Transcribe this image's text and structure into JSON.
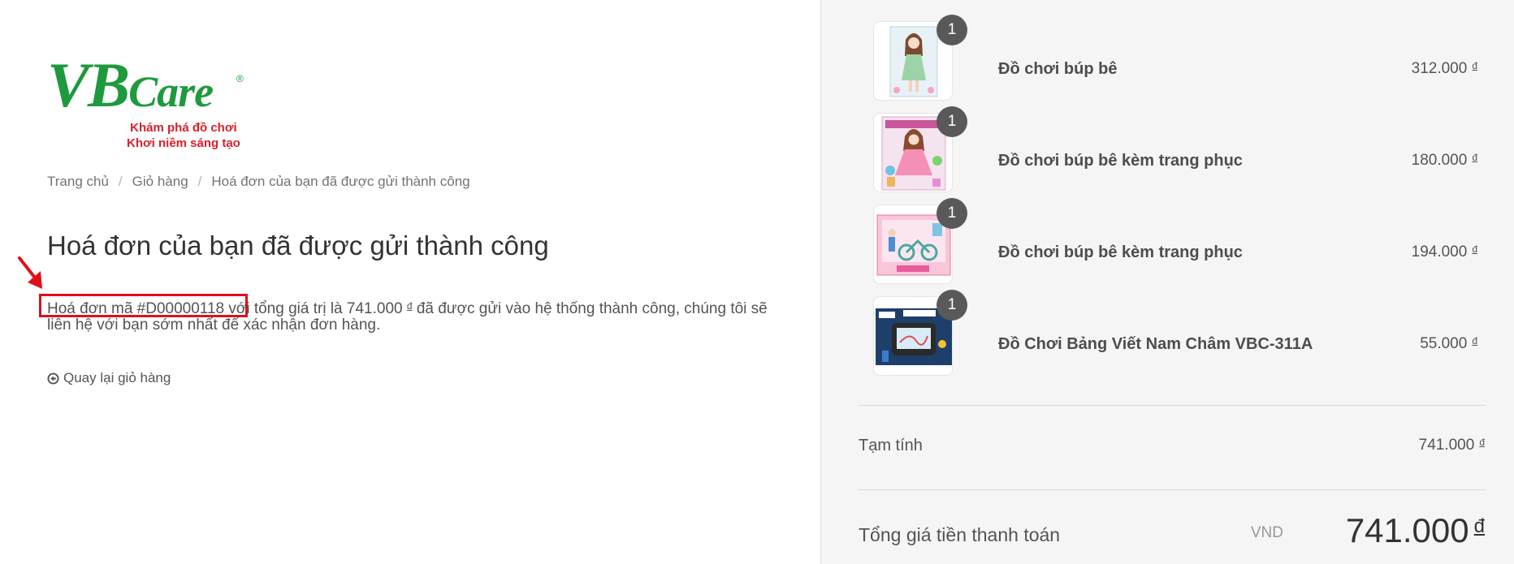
{
  "logo": {
    "brand_vb": "VB",
    "brand_care": "Care",
    "reg": "®",
    "tagline_1": "Khám phá đồ chơi",
    "tagline_2": "Khơi niềm sáng tạo"
  },
  "breadcrumb": {
    "home": "Trang chủ",
    "cart": "Giỏ hàng",
    "current": "Hoá đơn của bạn đã được gửi thành công",
    "separator": "/"
  },
  "page_title": "Hoá đơn của bạn đã được gửi thành công",
  "message": {
    "ref_text": "Hoá đơn mã #D00000118",
    "part1": " với tổng giá trị là 741.000 ",
    "currency": "đ",
    "part2": " đã được gửi vào hệ thống thành công, chúng tôi sẽ liên hệ với bạn sớm nhất để xác nhận đơn hàng."
  },
  "back_link": "Quay lại giỏ hàng",
  "items": [
    {
      "qty": "1",
      "name": "Đồ chơi búp bê",
      "price": "312.000",
      "currency": "đ",
      "thumb": "doll-in-box"
    },
    {
      "qty": "1",
      "name": "Đồ chơi búp bê kèm trang phục",
      "price": "180.000",
      "currency": "đ",
      "thumb": "doll-pink-dress"
    },
    {
      "qty": "1",
      "name": "Đồ chơi búp bê kèm trang phục",
      "price": "194.000",
      "currency": "đ",
      "thumb": "doll-bicycle-set"
    },
    {
      "qty": "1",
      "name": "Đồ Chơi Bảng Viết Nam Châm VBC-311A",
      "price": "55.000",
      "currency": "đ",
      "thumb": "magnetic-drawing-board"
    }
  ],
  "summary": {
    "subtotal_label": "Tạm tính",
    "subtotal_value": "741.000",
    "total_label": "Tổng giá tiền thanh toán",
    "total_currency_code": "VND",
    "total_value": "741.000",
    "currency": "đ"
  },
  "colors": {
    "brand_green": "#1e9a3e",
    "brand_red": "#d7202a",
    "highlight": "#e0101a",
    "sidebar_bg": "#f5f5f5",
    "qty_badge": "#595959"
  }
}
